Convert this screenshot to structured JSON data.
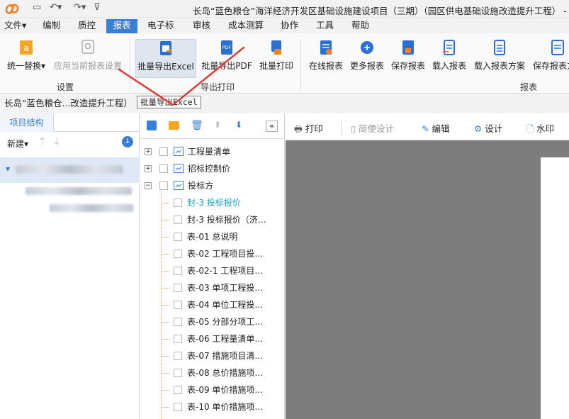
{
  "app": {
    "title": "长岛“蓝色粮仓”海洋经济开发区基础设施建设项目（三期）（园区供电基础设施改造提升工程） - D:/"
  },
  "menu": [
    "文件",
    "编制",
    "质控",
    "报表",
    "电子标",
    "审核",
    "成本测算",
    "协作",
    "工具",
    "帮助"
  ],
  "ribbon": {
    "buttons": {
      "replace": "统一替换",
      "apply_current": "应用当前报表设置",
      "batch_excel": "批量导出Excel",
      "batch_pdf": "批量导出PDF",
      "batch_print": "批量打印",
      "online_report": "在线报表",
      "more_report": "更多报表",
      "save_report": "保存报表",
      "load_report": "载入报表",
      "load_scheme": "载入报表方案",
      "save_scheme": "保存报表方"
    },
    "groups": {
      "settings": "设置",
      "export_print": "导出打印",
      "report": "报表"
    }
  },
  "breadcrumb": "长岛“蓝色粮仓...改造提升工程）",
  "tooltip": "批量导出Excel",
  "left_panel": {
    "tab": "项目结构",
    "filter_label": "新建"
  },
  "tree": {
    "nodes": [
      {
        "label": "工程量清单",
        "expander": "+"
      },
      {
        "label": "招标控制价",
        "expander": "+"
      },
      {
        "label": "投标方",
        "expander": "−"
      }
    ],
    "children": [
      "封-3  投标报价",
      "封-3 投标报价（济…",
      "表-01 总说明",
      "表-02 工程项目投…",
      "表-02-1 工程项目…",
      "表-03 单项工程投…",
      "表-04 单位工程投…",
      "表-05 分部分项工…",
      "表-06 工程量清单…",
      "表-07 措施项目清…",
      "表-08 总价措施项…",
      "表-09 单价措施项…",
      "表-10 单价措施项…"
    ]
  },
  "preview_toolbar": {
    "print": "打印",
    "simple_design": "简便设计",
    "edit": "编辑",
    "design": "设计",
    "watermark": "水印"
  },
  "colors": {
    "accent": "#3a7fd6",
    "active_item": "#1aa3c6",
    "annotation": "#e53935"
  }
}
